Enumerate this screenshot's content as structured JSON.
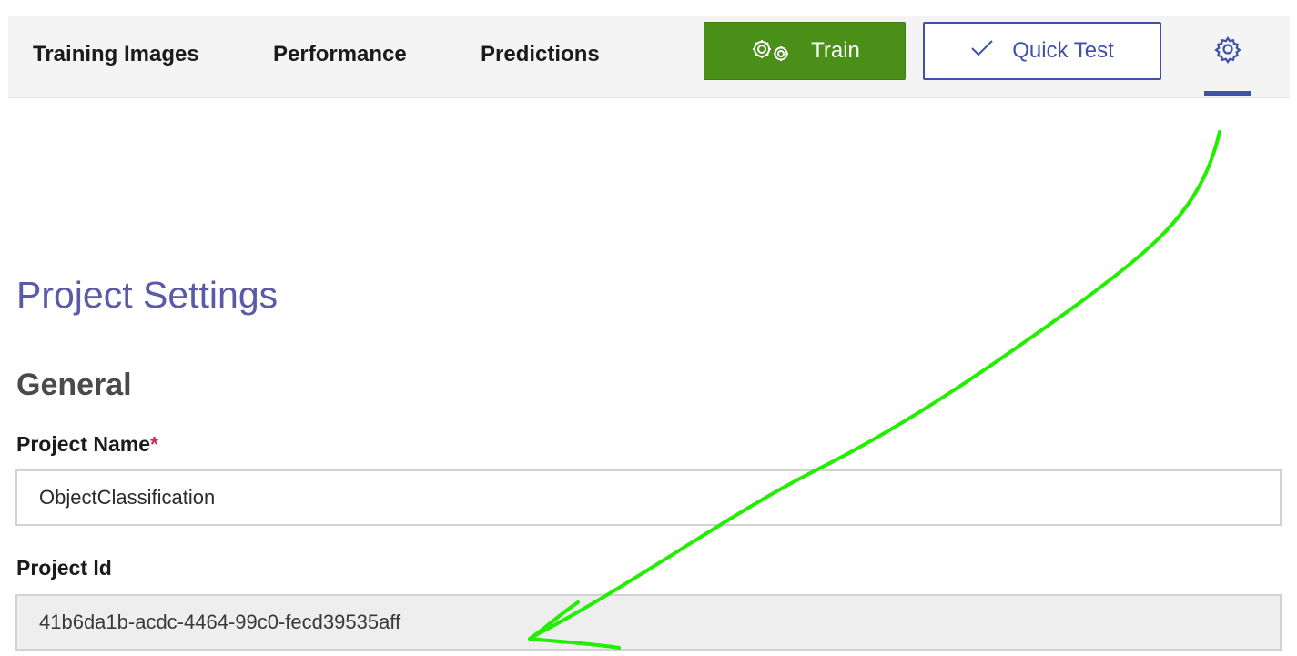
{
  "nav": {
    "tabs": [
      {
        "label": "Training Images"
      },
      {
        "label": "Performance"
      },
      {
        "label": "Predictions"
      }
    ],
    "train_button": {
      "label": "Train",
      "icon": "gears-icon"
    },
    "quick_test_button": {
      "label": "Quick Test",
      "icon": "checkmark-icon"
    },
    "settings": {
      "icon": "gear-icon",
      "active": true
    }
  },
  "main": {
    "title": "Project Settings",
    "section": "General",
    "fields": [
      {
        "label": "Project Name",
        "required_mark": "*",
        "value": "ObjectClassification",
        "readonly": false
      },
      {
        "label": "Project Id",
        "required_mark": "",
        "value": "41b6da1b-acdc-4464-99c0-fecd39535aff",
        "readonly": true
      }
    ]
  },
  "colors": {
    "accent": "#3f51a8",
    "train_green": "#4a8f18",
    "title_purple": "#5a5aa6",
    "required_red": "#c4314b",
    "annotation_arrow": "#22ee00"
  }
}
